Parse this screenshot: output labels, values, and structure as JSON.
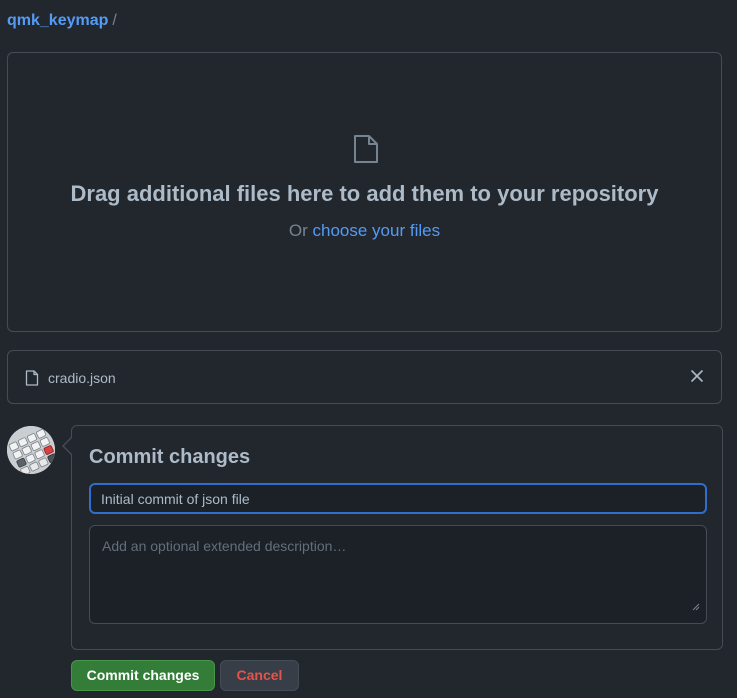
{
  "breadcrumb": {
    "repo": "qmk_keymap",
    "separator": "/"
  },
  "dropzone": {
    "icon": "file-icon",
    "title": "Drag additional files here to add them to your repository",
    "prefix": "Or",
    "link": "choose your files"
  },
  "file": {
    "name": "cradio.json",
    "icon": "file-icon",
    "remove_icon": "close-icon"
  },
  "commit": {
    "heading": "Commit changes",
    "message": "Initial commit of json file",
    "description_placeholder": "Add an optional extended description…",
    "submit_label": "Commit changes",
    "cancel_label": "Cancel"
  },
  "colors": {
    "accent": "#539bf5",
    "primary": "#347d39",
    "danger": "#e5534b",
    "background": "#22272e"
  }
}
